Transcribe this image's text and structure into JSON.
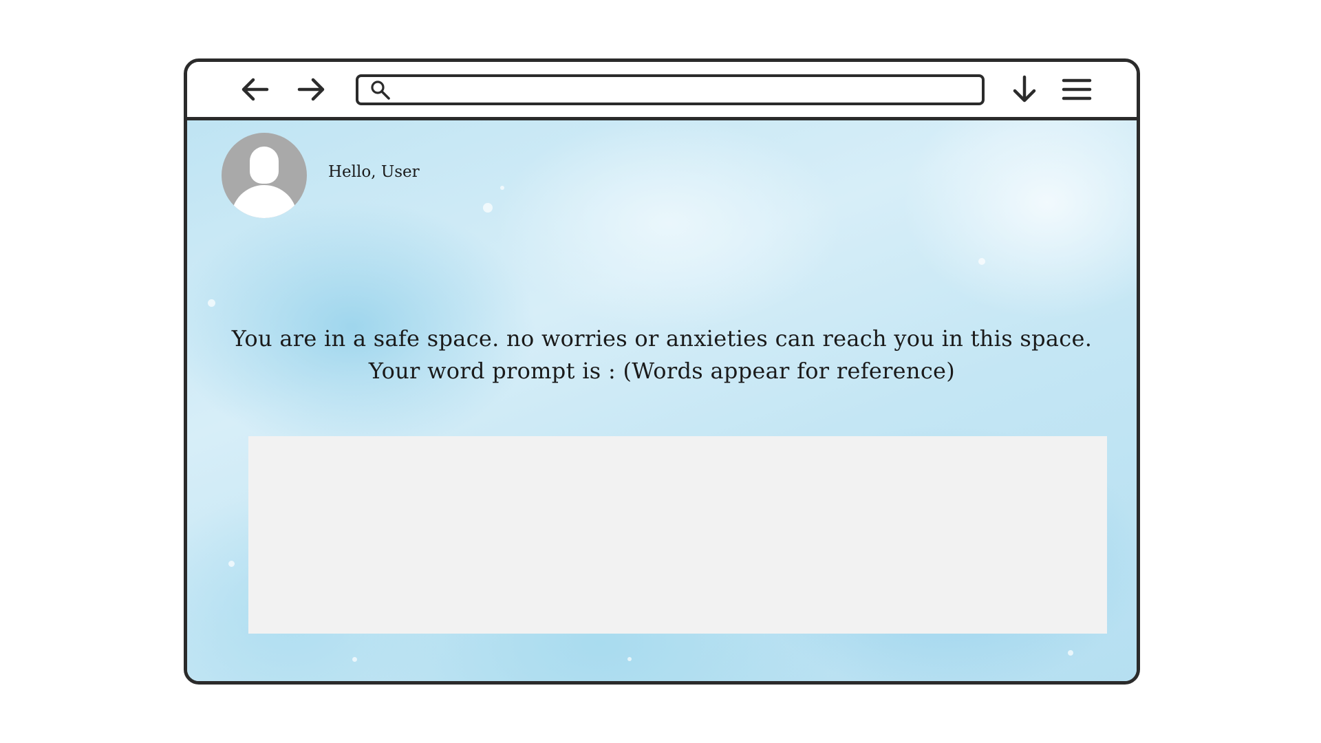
{
  "toolbar": {
    "back_icon": "arrow-left-icon",
    "forward_icon": "arrow-right-icon",
    "search_icon": "search-icon",
    "address_value": "",
    "download_icon": "arrow-down-icon",
    "menu_icon": "hamburger-menu-icon"
  },
  "user": {
    "avatar_icon": "user-avatar-icon",
    "greeting": "Hello, User"
  },
  "main": {
    "prompt_line_1": "You are in a safe space. no worries or anxieties can reach you in this space.",
    "prompt_line_2": "Your word prompt is : (Words appear for reference)",
    "response_value": ""
  },
  "colors": {
    "frame": "#2b2b2b",
    "background_accent": "#bfe4f3",
    "avatar_gray": "#a9a9a9",
    "response_box": "#f2f2f2",
    "text": "#1a1a1a"
  }
}
